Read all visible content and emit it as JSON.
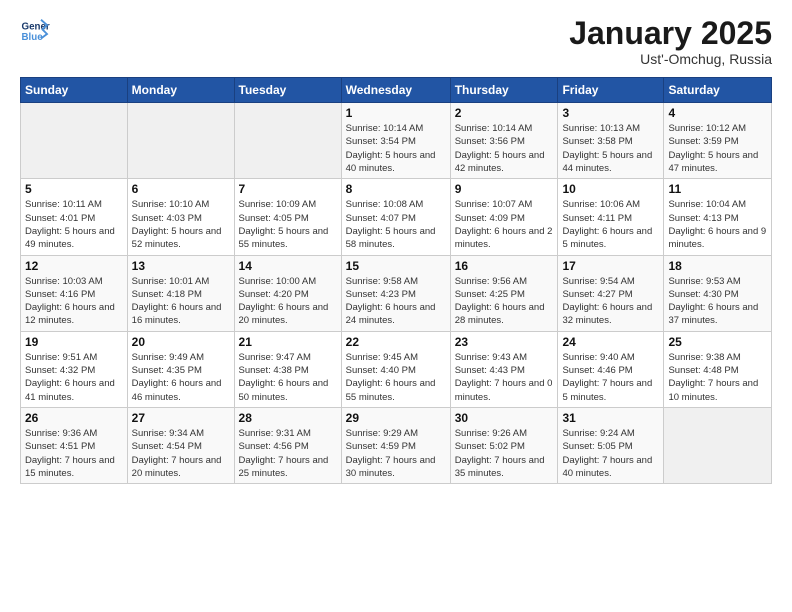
{
  "header": {
    "logo_line1": "General",
    "logo_line2": "Blue",
    "month": "January 2025",
    "location": "Ust'-Omchug, Russia"
  },
  "weekdays": [
    "Sunday",
    "Monday",
    "Tuesday",
    "Wednesday",
    "Thursday",
    "Friday",
    "Saturday"
  ],
  "weeks": [
    [
      {
        "day": "",
        "sunrise": "",
        "sunset": "",
        "daylight": ""
      },
      {
        "day": "",
        "sunrise": "",
        "sunset": "",
        "daylight": ""
      },
      {
        "day": "",
        "sunrise": "",
        "sunset": "",
        "daylight": ""
      },
      {
        "day": "1",
        "sunrise": "Sunrise: 10:14 AM",
        "sunset": "Sunset: 3:54 PM",
        "daylight": "Daylight: 5 hours and 40 minutes."
      },
      {
        "day": "2",
        "sunrise": "Sunrise: 10:14 AM",
        "sunset": "Sunset: 3:56 PM",
        "daylight": "Daylight: 5 hours and 42 minutes."
      },
      {
        "day": "3",
        "sunrise": "Sunrise: 10:13 AM",
        "sunset": "Sunset: 3:58 PM",
        "daylight": "Daylight: 5 hours and 44 minutes."
      },
      {
        "day": "4",
        "sunrise": "Sunrise: 10:12 AM",
        "sunset": "Sunset: 3:59 PM",
        "daylight": "Daylight: 5 hours and 47 minutes."
      }
    ],
    [
      {
        "day": "5",
        "sunrise": "Sunrise: 10:11 AM",
        "sunset": "Sunset: 4:01 PM",
        "daylight": "Daylight: 5 hours and 49 minutes."
      },
      {
        "day": "6",
        "sunrise": "Sunrise: 10:10 AM",
        "sunset": "Sunset: 4:03 PM",
        "daylight": "Daylight: 5 hours and 52 minutes."
      },
      {
        "day": "7",
        "sunrise": "Sunrise: 10:09 AM",
        "sunset": "Sunset: 4:05 PM",
        "daylight": "Daylight: 5 hours and 55 minutes."
      },
      {
        "day": "8",
        "sunrise": "Sunrise: 10:08 AM",
        "sunset": "Sunset: 4:07 PM",
        "daylight": "Daylight: 5 hours and 58 minutes."
      },
      {
        "day": "9",
        "sunrise": "Sunrise: 10:07 AM",
        "sunset": "Sunset: 4:09 PM",
        "daylight": "Daylight: 6 hours and 2 minutes."
      },
      {
        "day": "10",
        "sunrise": "Sunrise: 10:06 AM",
        "sunset": "Sunset: 4:11 PM",
        "daylight": "Daylight: 6 hours and 5 minutes."
      },
      {
        "day": "11",
        "sunrise": "Sunrise: 10:04 AM",
        "sunset": "Sunset: 4:13 PM",
        "daylight": "Daylight: 6 hours and 9 minutes."
      }
    ],
    [
      {
        "day": "12",
        "sunrise": "Sunrise: 10:03 AM",
        "sunset": "Sunset: 4:16 PM",
        "daylight": "Daylight: 6 hours and 12 minutes."
      },
      {
        "day": "13",
        "sunrise": "Sunrise: 10:01 AM",
        "sunset": "Sunset: 4:18 PM",
        "daylight": "Daylight: 6 hours and 16 minutes."
      },
      {
        "day": "14",
        "sunrise": "Sunrise: 10:00 AM",
        "sunset": "Sunset: 4:20 PM",
        "daylight": "Daylight: 6 hours and 20 minutes."
      },
      {
        "day": "15",
        "sunrise": "Sunrise: 9:58 AM",
        "sunset": "Sunset: 4:23 PM",
        "daylight": "Daylight: 6 hours and 24 minutes."
      },
      {
        "day": "16",
        "sunrise": "Sunrise: 9:56 AM",
        "sunset": "Sunset: 4:25 PM",
        "daylight": "Daylight: 6 hours and 28 minutes."
      },
      {
        "day": "17",
        "sunrise": "Sunrise: 9:54 AM",
        "sunset": "Sunset: 4:27 PM",
        "daylight": "Daylight: 6 hours and 32 minutes."
      },
      {
        "day": "18",
        "sunrise": "Sunrise: 9:53 AM",
        "sunset": "Sunset: 4:30 PM",
        "daylight": "Daylight: 6 hours and 37 minutes."
      }
    ],
    [
      {
        "day": "19",
        "sunrise": "Sunrise: 9:51 AM",
        "sunset": "Sunset: 4:32 PM",
        "daylight": "Daylight: 6 hours and 41 minutes."
      },
      {
        "day": "20",
        "sunrise": "Sunrise: 9:49 AM",
        "sunset": "Sunset: 4:35 PM",
        "daylight": "Daylight: 6 hours and 46 minutes."
      },
      {
        "day": "21",
        "sunrise": "Sunrise: 9:47 AM",
        "sunset": "Sunset: 4:38 PM",
        "daylight": "Daylight: 6 hours and 50 minutes."
      },
      {
        "day": "22",
        "sunrise": "Sunrise: 9:45 AM",
        "sunset": "Sunset: 4:40 PM",
        "daylight": "Daylight: 6 hours and 55 minutes."
      },
      {
        "day": "23",
        "sunrise": "Sunrise: 9:43 AM",
        "sunset": "Sunset: 4:43 PM",
        "daylight": "Daylight: 7 hours and 0 minutes."
      },
      {
        "day": "24",
        "sunrise": "Sunrise: 9:40 AM",
        "sunset": "Sunset: 4:46 PM",
        "daylight": "Daylight: 7 hours and 5 minutes."
      },
      {
        "day": "25",
        "sunrise": "Sunrise: 9:38 AM",
        "sunset": "Sunset: 4:48 PM",
        "daylight": "Daylight: 7 hours and 10 minutes."
      }
    ],
    [
      {
        "day": "26",
        "sunrise": "Sunrise: 9:36 AM",
        "sunset": "Sunset: 4:51 PM",
        "daylight": "Daylight: 7 hours and 15 minutes."
      },
      {
        "day": "27",
        "sunrise": "Sunrise: 9:34 AM",
        "sunset": "Sunset: 4:54 PM",
        "daylight": "Daylight: 7 hours and 20 minutes."
      },
      {
        "day": "28",
        "sunrise": "Sunrise: 9:31 AM",
        "sunset": "Sunset: 4:56 PM",
        "daylight": "Daylight: 7 hours and 25 minutes."
      },
      {
        "day": "29",
        "sunrise": "Sunrise: 9:29 AM",
        "sunset": "Sunset: 4:59 PM",
        "daylight": "Daylight: 7 hours and 30 minutes."
      },
      {
        "day": "30",
        "sunrise": "Sunrise: 9:26 AM",
        "sunset": "Sunset: 5:02 PM",
        "daylight": "Daylight: 7 hours and 35 minutes."
      },
      {
        "day": "31",
        "sunrise": "Sunrise: 9:24 AM",
        "sunset": "Sunset: 5:05 PM",
        "daylight": "Daylight: 7 hours and 40 minutes."
      },
      {
        "day": "",
        "sunrise": "",
        "sunset": "",
        "daylight": ""
      }
    ]
  ]
}
